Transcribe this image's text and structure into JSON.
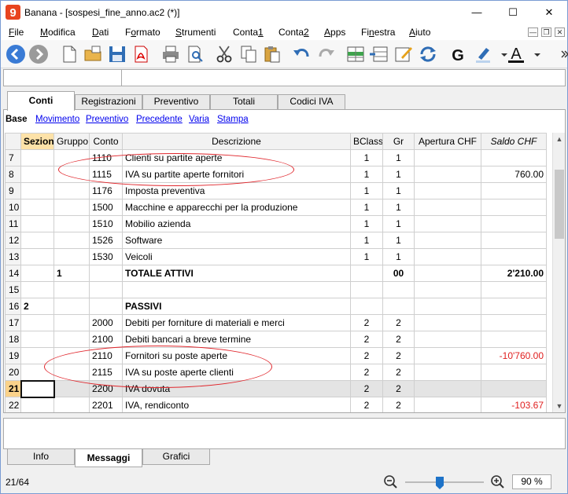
{
  "window": {
    "title": "Banana - [sospesi_fine_anno.ac2 (*)]",
    "min": "—",
    "max": "☐",
    "close": "✕"
  },
  "menu": [
    {
      "pre": "",
      "u": "F",
      "post": "ile"
    },
    {
      "pre": "",
      "u": "M",
      "post": "odifica"
    },
    {
      "pre": "",
      "u": "D",
      "post": "ati"
    },
    {
      "pre": "F",
      "u": "o",
      "post": "rmato"
    },
    {
      "pre": "",
      "u": "S",
      "post": "trumenti"
    },
    {
      "pre": "Conta",
      "u": "1",
      "post": ""
    },
    {
      "pre": "Conta",
      "u": "2",
      "post": ""
    },
    {
      "pre": "",
      "u": "A",
      "post": "pps"
    },
    {
      "pre": "Fi",
      "u": "n",
      "post": "estra"
    },
    {
      "pre": "",
      "u": "A",
      "post": "iuto"
    }
  ],
  "tabs": [
    "Conti",
    "Registrazioni",
    "Preventivo",
    "Totali",
    "Codici IVA"
  ],
  "views": {
    "current": "Base",
    "links": [
      "Movimento",
      "Preventivo",
      "Precedente",
      "Varia",
      "Stampa"
    ]
  },
  "columns": [
    "",
    "Sezione",
    "Gruppo",
    "Conto",
    "Descrizione",
    "BClasse",
    "Gr",
    "Apertura CHF",
    "Saldo CHF"
  ],
  "rows": [
    {
      "n": "7",
      "sez": "",
      "grp": "",
      "conto": "1110",
      "desc": "Clienti su partite aperte",
      "bc": "1",
      "gr": "1",
      "ap": "",
      "saldo": ""
    },
    {
      "n": "8",
      "sez": "",
      "grp": "",
      "conto": "1115",
      "desc": "IVA su partite aperte fornitori",
      "bc": "1",
      "gr": "1",
      "ap": "",
      "saldo": "760.00"
    },
    {
      "n": "9",
      "sez": "",
      "grp": "",
      "conto": "1176",
      "desc": "Imposta preventiva",
      "bc": "1",
      "gr": "1",
      "ap": "",
      "saldo": ""
    },
    {
      "n": "10",
      "sez": "",
      "grp": "",
      "conto": "1500",
      "desc": "Macchine e apparecchi per la produzione",
      "bc": "1",
      "gr": "1",
      "ap": "",
      "saldo": ""
    },
    {
      "n": "11",
      "sez": "",
      "grp": "",
      "conto": "1510",
      "desc": "Mobilio azienda",
      "bc": "1",
      "gr": "1",
      "ap": "",
      "saldo": ""
    },
    {
      "n": "12",
      "sez": "",
      "grp": "",
      "conto": "1526",
      "desc": "Software",
      "bc": "1",
      "gr": "1",
      "ap": "",
      "saldo": ""
    },
    {
      "n": "13",
      "sez": "",
      "grp": "",
      "conto": "1530",
      "desc": "Veicoli",
      "bc": "1",
      "gr": "1",
      "ap": "",
      "saldo": ""
    },
    {
      "n": "14",
      "sez": "",
      "grp": "1",
      "conto": "",
      "desc": "TOTALE ATTIVI",
      "bc": "",
      "gr": "00",
      "ap": "",
      "saldo": "2'210.00",
      "bold": true
    },
    {
      "n": "15",
      "sez": "",
      "grp": "",
      "conto": "",
      "desc": "",
      "bc": "",
      "gr": "",
      "ap": "",
      "saldo": ""
    },
    {
      "n": "16",
      "sez": "2",
      "grp": "",
      "conto": "",
      "desc": "PASSIVI",
      "bc": "",
      "gr": "",
      "ap": "",
      "saldo": "",
      "bold": true
    },
    {
      "n": "17",
      "sez": "",
      "grp": "",
      "conto": "2000",
      "desc": "Debiti per forniture di materiali e merci",
      "bc": "2",
      "gr": "2",
      "ap": "",
      "saldo": ""
    },
    {
      "n": "18",
      "sez": "",
      "grp": "",
      "conto": "2100",
      "desc": "Debiti bancari a breve termine",
      "bc": "2",
      "gr": "2",
      "ap": "",
      "saldo": ""
    },
    {
      "n": "19",
      "sez": "",
      "grp": "",
      "conto": "2110",
      "desc": "Fornitori su poste aperte",
      "bc": "2",
      "gr": "2",
      "ap": "",
      "saldo": "-10'760.00",
      "neg": true
    },
    {
      "n": "20",
      "sez": "",
      "grp": "",
      "conto": "2115",
      "desc": "IVA su poste aperte clienti",
      "bc": "2",
      "gr": "2",
      "ap": "",
      "saldo": ""
    },
    {
      "n": "21",
      "sez": "",
      "grp": "",
      "conto": "2200",
      "desc": "IVA dovuta",
      "bc": "2",
      "gr": "2",
      "ap": "",
      "saldo": "",
      "current": true
    },
    {
      "n": "22",
      "sez": "",
      "grp": "",
      "conto": "2201",
      "desc": "IVA, rendiconto",
      "bc": "2",
      "gr": "2",
      "ap": "",
      "saldo": "-103.67",
      "neg": true
    }
  ],
  "bottom_tabs": [
    "Info",
    "Messaggi",
    "Grafici"
  ],
  "status": {
    "position": "21/64",
    "zoom": "90 %",
    "zoom_level_percent": 90
  }
}
